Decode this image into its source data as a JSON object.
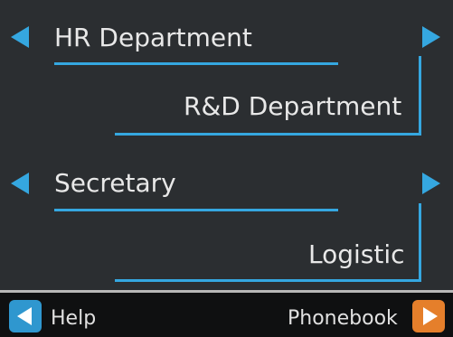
{
  "screen": {
    "rows": [
      {
        "left_label": "HR Department",
        "right_label": "R&D Department"
      },
      {
        "left_label": "Secretary",
        "right_label": "Logistic"
      }
    ]
  },
  "softkeys": {
    "left_label": "Help",
    "right_label": "Phonebook"
  },
  "colors": {
    "background": "#2b2e31",
    "accent": "#35a7e0",
    "bottom_bar": "#0f1011",
    "softkey_left": "#2f97cf",
    "softkey_right": "#e57f2b"
  },
  "icons": {
    "row_prev": "arrow-left-icon",
    "row_next": "arrow-right-icon",
    "softkey_left": "softkey-left-icon",
    "softkey_right": "softkey-right-icon"
  }
}
